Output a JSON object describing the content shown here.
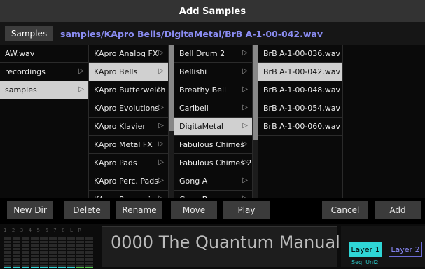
{
  "title": "Add Samples",
  "pathbar": {
    "samples_button": "Samples",
    "path": "samples/KApro Bells/DigitaMetal/BrB A-1-00-042.wav"
  },
  "columns": [
    {
      "items": [
        {
          "label": "AW.wav",
          "arrow": false,
          "selected": false
        },
        {
          "label": "recordings",
          "arrow": true,
          "selected": false
        },
        {
          "label": "samples",
          "arrow": true,
          "selected": true
        }
      ]
    },
    {
      "items": [
        {
          "label": "KApro Analog FX",
          "arrow": true,
          "selected": false
        },
        {
          "label": "KApro Bells",
          "arrow": true,
          "selected": true
        },
        {
          "label": "KApro Butterweich",
          "arrow": true,
          "selected": false
        },
        {
          "label": "KApro Evolutions",
          "arrow": true,
          "selected": false
        },
        {
          "label": "KApro Klavier",
          "arrow": true,
          "selected": false
        },
        {
          "label": "KApro Metal FX",
          "arrow": true,
          "selected": false
        },
        {
          "label": "KApro Pads",
          "arrow": true,
          "selected": false
        },
        {
          "label": "KApro Perc. Pads",
          "arrow": true,
          "selected": false
        },
        {
          "label": "KApro Percussion",
          "arrow": true,
          "selected": false
        }
      ]
    },
    {
      "items": [
        {
          "label": "Bell Drum 2",
          "arrow": true,
          "selected": false
        },
        {
          "label": "Bellishi",
          "arrow": true,
          "selected": false
        },
        {
          "label": "Breathy Bell",
          "arrow": true,
          "selected": false
        },
        {
          "label": "Caribell",
          "arrow": true,
          "selected": false
        },
        {
          "label": "DigitaMetal",
          "arrow": true,
          "selected": true
        },
        {
          "label": "Fabulous Chimes",
          "arrow": true,
          "selected": false
        },
        {
          "label": "Fabulous Chimes 2",
          "arrow": true,
          "selected": false
        },
        {
          "label": "Gong A",
          "arrow": true,
          "selected": false
        },
        {
          "label": "Gong B",
          "arrow": true,
          "selected": false
        }
      ]
    },
    {
      "items": [
        {
          "label": "BrB A-1-00-036.wav",
          "arrow": false,
          "selected": false
        },
        {
          "label": "BrB A-1-00-042.wav",
          "arrow": false,
          "selected": true
        },
        {
          "label": "BrB A-1-00-048.wav",
          "arrow": false,
          "selected": false
        },
        {
          "label": "BrB A-1-00-054.wav",
          "arrow": false,
          "selected": false
        },
        {
          "label": "BrB A-1-00-060.wav",
          "arrow": false,
          "selected": false
        }
      ]
    }
  ],
  "buttons": {
    "new_dir": "New Dir",
    "delete": "Delete",
    "rename": "Rename",
    "move": "Move",
    "play": "Play",
    "cancel": "Cancel",
    "add": "Add"
  },
  "status": {
    "meter_labels": "1 2 3 4 5 6 7 8 L R",
    "display": "0000 The Quantum Manual",
    "layer1": "Layer 1",
    "layer2": "Layer 2",
    "seq": "Seq. Uni2"
  },
  "colors": {
    "accent_cyan": "#2fd6d6",
    "path_blue": "#8a8cf2",
    "selected_bg": "#d0d0d0"
  }
}
